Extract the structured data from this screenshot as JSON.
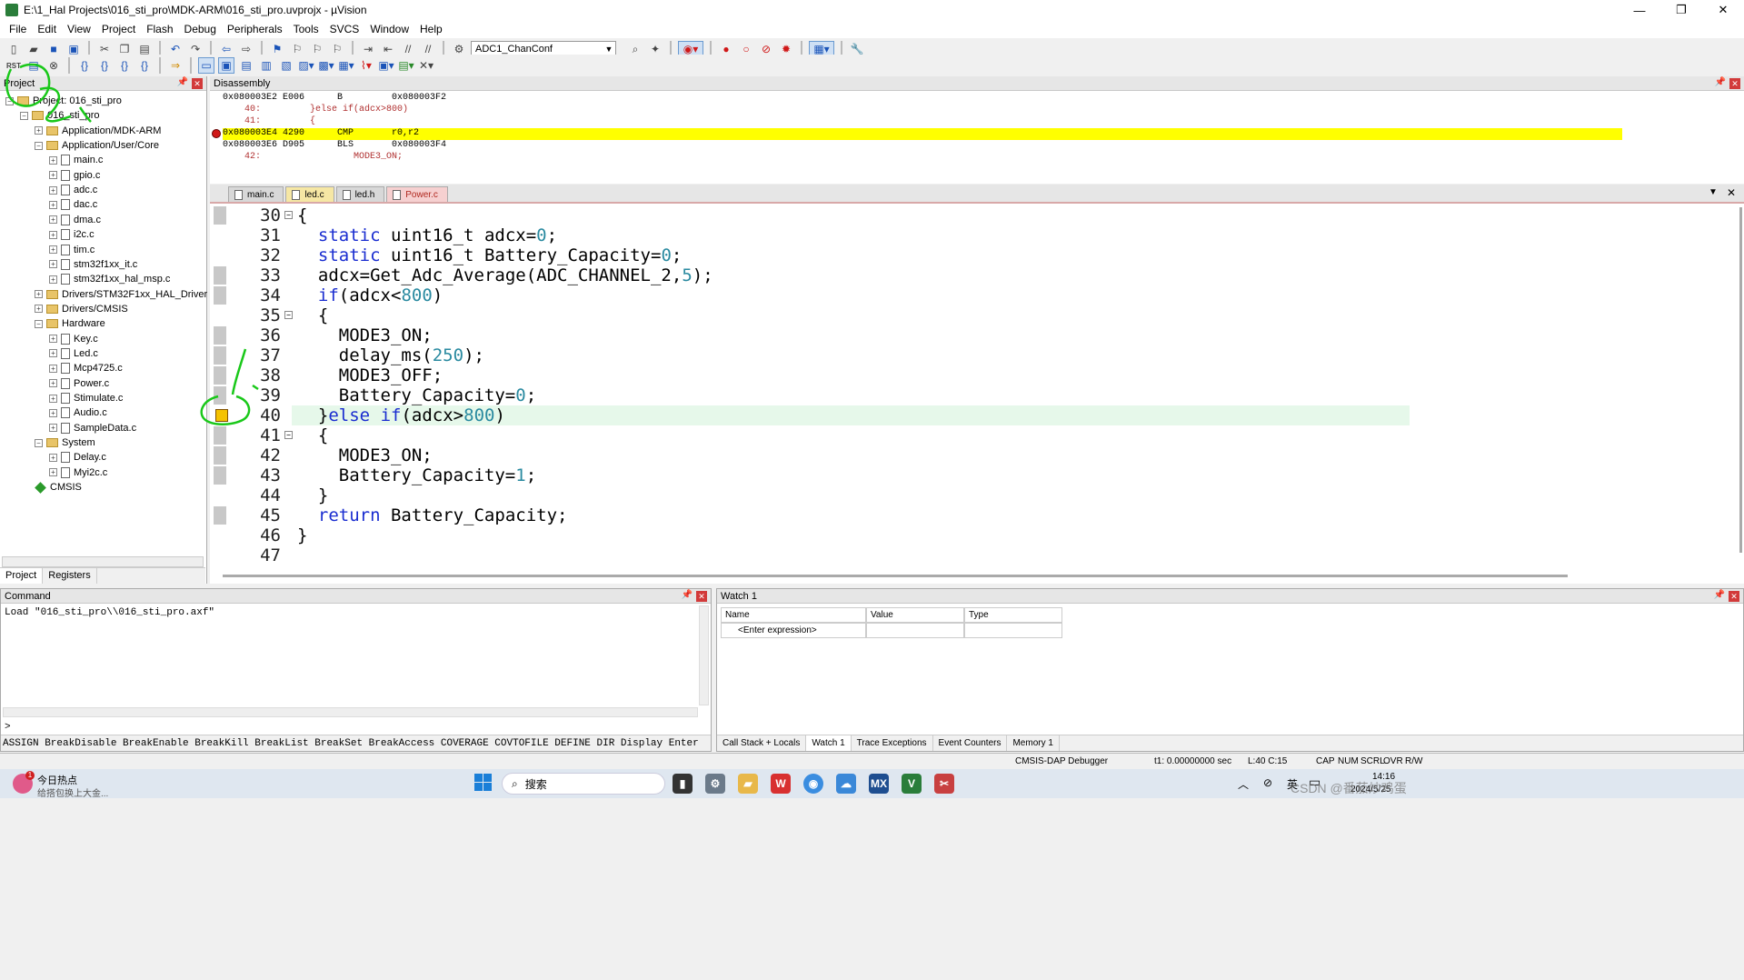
{
  "window": {
    "title": "E:\\1_Hal Projects\\016_sti_pro\\MDK-ARM\\016_sti_pro.uvprojx - µVision",
    "controls": [
      "—",
      "❐",
      "✕"
    ]
  },
  "menu": [
    "File",
    "Edit",
    "View",
    "Project",
    "Flash",
    "Debug",
    "Peripherals",
    "Tools",
    "SVCS",
    "Window",
    "Help"
  ],
  "toolbar": {
    "target_combo": "ADC1_ChanConf"
  },
  "project_panel": {
    "title": "Project",
    "tree": [
      {
        "label": "Project: 016_sti_pro",
        "depth": 0,
        "type": "root",
        "expander": "−"
      },
      {
        "label": "016_sti_pro",
        "depth": 1,
        "type": "folder",
        "expander": "−"
      },
      {
        "label": "Application/MDK-ARM",
        "depth": 2,
        "type": "folder",
        "expander": "+"
      },
      {
        "label": "Application/User/Core",
        "depth": 2,
        "type": "folder",
        "expander": "−"
      },
      {
        "label": "main.c",
        "depth": 3,
        "type": "file",
        "expander": "+"
      },
      {
        "label": "gpio.c",
        "depth": 3,
        "type": "file",
        "expander": "+"
      },
      {
        "label": "adc.c",
        "depth": 3,
        "type": "file",
        "expander": "+"
      },
      {
        "label": "dac.c",
        "depth": 3,
        "type": "file",
        "expander": "+"
      },
      {
        "label": "dma.c",
        "depth": 3,
        "type": "file",
        "expander": "+"
      },
      {
        "label": "i2c.c",
        "depth": 3,
        "type": "file",
        "expander": "+"
      },
      {
        "label": "tim.c",
        "depth": 3,
        "type": "file",
        "expander": "+"
      },
      {
        "label": "stm32f1xx_it.c",
        "depth": 3,
        "type": "file",
        "expander": "+"
      },
      {
        "label": "stm32f1xx_hal_msp.c",
        "depth": 3,
        "type": "file",
        "expander": "+"
      },
      {
        "label": "Drivers/STM32F1xx_HAL_Driver",
        "depth": 2,
        "type": "folder",
        "expander": "+"
      },
      {
        "label": "Drivers/CMSIS",
        "depth": 2,
        "type": "folder",
        "expander": "+"
      },
      {
        "label": "Hardware",
        "depth": 2,
        "type": "folder",
        "expander": "−"
      },
      {
        "label": "Key.c",
        "depth": 3,
        "type": "file",
        "expander": "+"
      },
      {
        "label": "Led.c",
        "depth": 3,
        "type": "file",
        "expander": "+"
      },
      {
        "label": "Mcp4725.c",
        "depth": 3,
        "type": "file",
        "expander": "+"
      },
      {
        "label": "Power.c",
        "depth": 3,
        "type": "file",
        "expander": "+"
      },
      {
        "label": "Stimulate.c",
        "depth": 3,
        "type": "file",
        "expander": "+"
      },
      {
        "label": "Audio.c",
        "depth": 3,
        "type": "file",
        "expander": "+"
      },
      {
        "label": "SampleData.c",
        "depth": 3,
        "type": "file",
        "expander": "+"
      },
      {
        "label": "System",
        "depth": 2,
        "type": "folder",
        "expander": "−"
      },
      {
        "label": "Delay.c",
        "depth": 3,
        "type": "file",
        "expander": "+"
      },
      {
        "label": "Myi2c.c",
        "depth": 3,
        "type": "file",
        "expander": "+"
      },
      {
        "label": "CMSIS",
        "depth": 2,
        "type": "cmsis",
        "expander": ""
      }
    ],
    "tabs": [
      "Project",
      "Registers"
    ]
  },
  "disassembly": {
    "title": "Disassembly",
    "lines": [
      {
        "text": "0x080003E2 E006      B         0x080003F2",
        "hl": false
      },
      {
        "text": "    40: \t}else if(adcx>800)",
        "hl": false
      },
      {
        "text": "    41: \t{",
        "hl": false
      },
      {
        "text": "0x080003E4 4290      CMP       r0,r2",
        "hl": true
      },
      {
        "text": "0x080003E6 D905      BLS       0x080003F4",
        "hl": false
      },
      {
        "text": "    42: \t\tMODE3_ON;",
        "hl": false
      }
    ]
  },
  "editor": {
    "tabs": [
      {
        "label": "main.c",
        "style": "plain"
      },
      {
        "label": "led.c",
        "style": "yel"
      },
      {
        "label": "led.h",
        "style": "plain"
      },
      {
        "label": "Power.c",
        "style": "act"
      }
    ],
    "lines": [
      {
        "n": "30",
        "fold": "−",
        "code": "{"
      },
      {
        "n": "31",
        "fold": "",
        "code": "  static uint16_t adcx=0;"
      },
      {
        "n": "32",
        "fold": "",
        "code": "  static uint16_t Battery_Capacity=0;"
      },
      {
        "n": "33",
        "fold": "",
        "code": "  adcx=Get_Adc_Average(ADC_CHANNEL_2,5);"
      },
      {
        "n": "34",
        "fold": "",
        "code": "  if(adcx<800)"
      },
      {
        "n": "35",
        "fold": "−",
        "code": "  {"
      },
      {
        "n": "36",
        "fold": "",
        "code": "    MODE3_ON;"
      },
      {
        "n": "37",
        "fold": "",
        "code": "    delay_ms(250);"
      },
      {
        "n": "38",
        "fold": "",
        "code": "    MODE3_OFF;"
      },
      {
        "n": "39",
        "fold": "",
        "code": "    Battery_Capacity=0;"
      },
      {
        "n": "40",
        "fold": "",
        "code": "  }else if(adcx>800)"
      },
      {
        "n": "41",
        "fold": "−",
        "code": "  {"
      },
      {
        "n": "42",
        "fold": "",
        "code": "    MODE3_ON;"
      },
      {
        "n": "43",
        "fold": "",
        "code": "    Battery_Capacity=1;"
      },
      {
        "n": "44",
        "fold": "",
        "code": "  }"
      },
      {
        "n": "45",
        "fold": "",
        "code": "  return Battery_Capacity;"
      },
      {
        "n": "46",
        "fold": "",
        "code": "}"
      },
      {
        "n": "47",
        "fold": "",
        "code": ""
      }
    ]
  },
  "command": {
    "title": "Command",
    "output": "Load \"016_sti_pro\\\\016_sti_pro.axf\"",
    "prompt": ">",
    "hint": "ASSIGN BreakDisable BreakEnable BreakKill BreakList BreakSet BreakAccess COVERAGE COVTOFILE DEFINE DIR Display Enter"
  },
  "watch": {
    "title": "Watch 1",
    "headers": [
      "Name",
      "Value",
      "Type"
    ],
    "enter": "<Enter expression>",
    "tabs": [
      "Call Stack + Locals",
      "Watch 1",
      "Trace Exceptions",
      "Event Counters",
      "Memory 1"
    ]
  },
  "status": {
    "debugger": "CMSIS-DAP Debugger",
    "time": "t1: 0.00000000 sec",
    "pos": "L:40 C:15",
    "flags": [
      "CAP",
      "NUM",
      "SCRL",
      "OVR",
      "R/W"
    ]
  },
  "taskbar": {
    "news_title": "今日热点",
    "news_sub": "给搭包换上大金...",
    "search": "搜索",
    "lang": "英",
    "time": "14:16",
    "date": "2024/5/25",
    "watermark": "CSDN @番茄炒鸡蛋"
  }
}
